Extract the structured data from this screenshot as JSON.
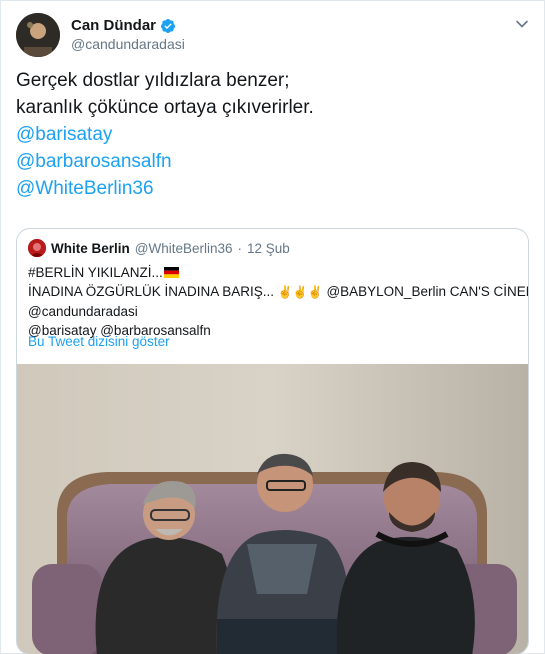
{
  "author": {
    "display_name": "Can Dündar",
    "handle": "@candundaradasi"
  },
  "tweet": {
    "lines": [
      "Gerçek dostlar yıldızlara benzer;",
      "karanlık çökünce ortaya çıkıverirler."
    ],
    "mentions": [
      "@barisatay",
      "@barbarosansalfn",
      "@WhiteBerlin36"
    ]
  },
  "quoted": {
    "display_name": "White Berlin",
    "handle": "@WhiteBerlin36",
    "separator": "·",
    "time": "12 Şub",
    "line1": "#BERLİN YIKILANZİ...",
    "line2": "İNADINA ÖZGÜRLÜK İNADINA BARIŞ...",
    "line2b": "@BABYLON_Berlin CAN'S CİNEMA",
    "line3": "@candundaradasi",
    "line4": "@barisatay @barbarosansalfn",
    "show_thread": "Bu Tweet dizisini göster"
  },
  "colors": {
    "accent": "#1da1f2",
    "text": "#14171a",
    "muted": "#657786",
    "border": "#ccd6dd"
  },
  "icons": [
    "verified-badge-icon",
    "chevron-down-icon",
    "germany-flag-icon",
    "victory-hand-icon"
  ]
}
